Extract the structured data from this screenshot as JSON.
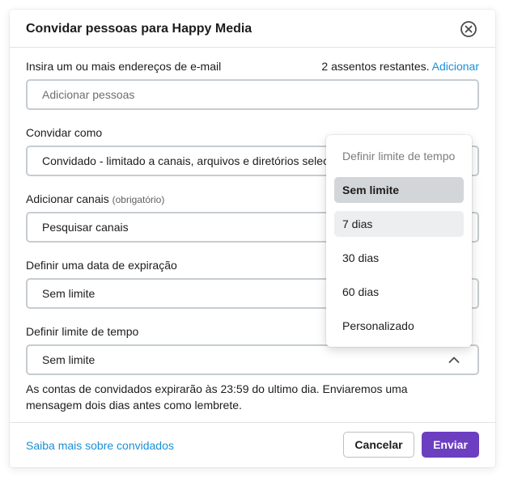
{
  "modal": {
    "title": "Convidar pessoas para Happy Media",
    "close_icon": "close-circle-icon"
  },
  "email": {
    "label": "Insira um ou mais endereços de e-mail",
    "seats_text": "2 assentos restantes.",
    "seats_link": "Adicionar",
    "placeholder": "Adicionar pessoas"
  },
  "invite_as": {
    "label": "Convidar como",
    "value": "Convidado - limitado a canais, arquivos e diretórios selecionados"
  },
  "channels": {
    "label": "Adicionar canais",
    "hint": "(obrigatório)",
    "placeholder": "Pesquisar canais"
  },
  "expiration": {
    "label": "Definir uma data de expiração",
    "value": "Sem limite"
  },
  "time_limit": {
    "label": "Definir limite de tempo",
    "value": "Sem limite",
    "chevron_icon": "chevron-up-icon"
  },
  "note": "As contas de convidados expirarão às 23:59 do ultimo dia. Enviaremos uma mensagem dois dias antes como lembrete.",
  "dropdown": {
    "header": "Definir limite de tempo",
    "selected_index": 0,
    "hover_index": 1,
    "options": [
      {
        "label": "Sem limite"
      },
      {
        "label": "7 dias"
      },
      {
        "label": "30 dias"
      },
      {
        "label": "60 dias"
      },
      {
        "label": "Personalizado"
      }
    ]
  },
  "footer": {
    "learn_more": "Saiba mais sobre convidados",
    "cancel": "Cancelar",
    "send": "Enviar"
  },
  "colors": {
    "accent": "#6c3fc0",
    "link": "#1a8fd6",
    "selected_bg": "#d3d6d8",
    "hover_bg": "#eceeef"
  }
}
